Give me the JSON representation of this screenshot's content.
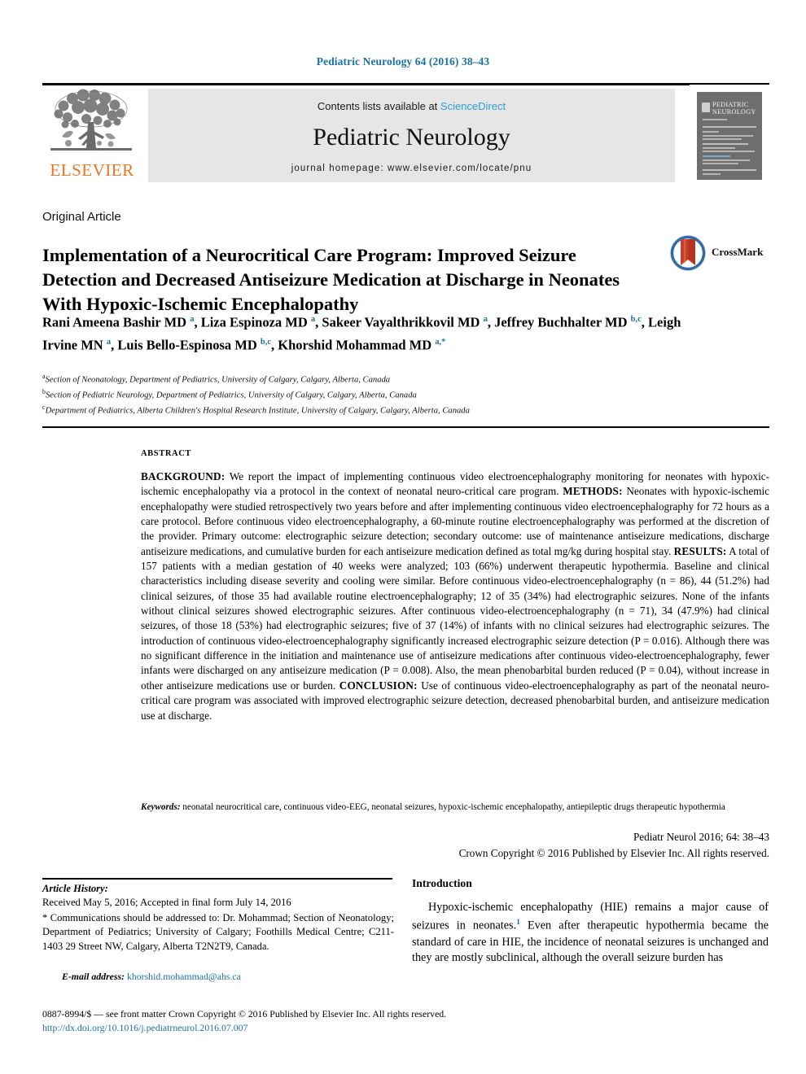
{
  "running_head": "Pediatric Neurology 64 (2016) 38–43",
  "masthead": {
    "contents_prefix": "Contents lists available at ",
    "sciencedirect": "ScienceDirect",
    "journal_title": "Pediatric Neurology",
    "homepage": "journal homepage: www.elsevier.com/locate/pnu",
    "publisher_logo_text": "ELSEVIER",
    "cover_title_line1": "PEDIATRIC",
    "cover_title_line2": "NEUROLOGY"
  },
  "article": {
    "type": "Original Article",
    "title": "Implementation of a Neurocritical Care Program: Improved Seizure Detection and Decreased Antiseizure Medication at Discharge in Neonates With Hypoxic-Ischemic Encephalopathy",
    "crossmark_label": "CrossMark",
    "authors_html": "Rani Ameena Bashir MD <sup>a</sup>, Liza Espinoza MD <sup>a</sup>, Sakeer Vayalthrikkovil MD <sup>a</sup>, Jeffrey Buchhalter MD <sup>b,c</sup>, Leigh Irvine MN <sup>a</sup>, Luis Bello-Espinosa MD <sup>b,c</sup>, Khorshid Mohammad MD <sup>a,</sup><sup>*</sup>",
    "affiliations": [
      {
        "marker": "a",
        "text": "Section of Neonatology, Department of Pediatrics, University of Calgary, Calgary, Alberta, Canada"
      },
      {
        "marker": "b",
        "text": "Section of Pediatric Neurology, Department of Pediatrics, University of Calgary, Calgary, Alberta, Canada"
      },
      {
        "marker": "c",
        "text": "Department of Pediatrics, Alberta Children's Hospital Research Institute, University of Calgary, Calgary, Alberta, Canada"
      }
    ]
  },
  "abstract": {
    "heading": "ABSTRACT",
    "sections": [
      {
        "label": "BACKGROUND:",
        "text": " We report the impact of implementing continuous video electroencephalography monitoring for neonates with hypoxic-ischemic encephalopathy via a protocol in the context of neonatal neuro-critical care program. "
      },
      {
        "label": "METHODS:",
        "text": " Neonates with hypoxic-ischemic encephalopathy were studied retrospectively two years before and after implementing continuous video electroencephalography for 72 hours as a care protocol. Before continuous video electroencephalography, a 60-minute routine electroencephalography was performed at the discretion of the provider. Primary outcome: electrographic seizure detection; secondary outcome: use of maintenance antiseizure medications, discharge antiseizure medications, and cumulative burden for each antiseizure medication defined as total mg/kg during hospital stay. "
      },
      {
        "label": "RESULTS:",
        "text": " A total of 157 patients with a median gestation of 40 weeks were analyzed; 103 (66%) underwent therapeutic hypothermia. Baseline and clinical characteristics including disease severity and cooling were similar. Before continuous video-electroencephalography (n = 86), 44 (51.2%) had clinical seizures, of those 35 had available routine electroencephalography; 12 of 35 (34%) had electrographic seizures. None of the infants without clinical seizures showed electrographic seizures. After continuous video-electroencephalography (n = 71), 34 (47.9%) had clinical seizures, of those 18 (53%) had electrographic seizures; five of 37 (14%) of infants with no clinical seizures had electrographic seizures. The introduction of continuous video-electroencephalography significantly increased electrographic seizure detection (P = 0.016). Although there was no significant difference in the initiation and maintenance use of antiseizure medications after continuous video-electroencephalography, fewer infants were discharged on any antiseizure medication (P = 0.008). Also, the mean phenobarbital burden reduced (P = 0.04), without increase in other antiseizure medications use or burden. "
      },
      {
        "label": "CONCLUSION:",
        "text": " Use of continuous video-electroencephalography as part of the neonatal neuro-critical care program was associated with improved electrographic seizure detection, decreased phenobarbital burden, and antiseizure medication use at discharge."
      }
    ],
    "keywords_label": "Keywords:",
    "keywords_text": " neonatal neurocritical care, continuous video-EEG, neonatal seizures, hypoxic-ischemic encephalopathy, antiepileptic drugs therapeutic hypothermia",
    "citation": "Pediatr Neurol 2016; 64: 38–43",
    "copyright": "Crown Copyright © 2016 Published by Elsevier Inc. All rights reserved."
  },
  "article_history": {
    "label": "Article History:",
    "dates": "Received May 5, 2016; Accepted in final form July 14, 2016",
    "correspondence": "* Communications should be addressed to: Dr. Mohammad; Section of Neonatology; Department of Pediatrics; University of Calgary; Foothills Medical Centre; C211-1403 29 Street NW, Calgary, Alberta T2N2T9, Canada.",
    "email_label": "E-mail address:",
    "email": " khorshid.mohammad@ahs.ca"
  },
  "introduction": {
    "heading": "Introduction",
    "paragraph_pre": "Hypoxic-ischemic encephalopathy (HIE) remains a major cause of seizures in neonates.",
    "reference_marker": "1",
    "paragraph_post": " Even after therapeutic hypothermia became the standard of care in HIE, the incidence of neonatal seizures is unchanged and they are mostly subclinical, although the overall seizure burden has"
  },
  "footer": {
    "issn_line": "0887-8994/$ — see front matter Crown Copyright © 2016 Published by Elsevier Inc. All rights reserved.",
    "doi": "http://dx.doi.org/10.1016/j.pediatrneurol.2016.07.007"
  },
  "colors": {
    "link_blue": "#1b72a8",
    "sciencedirect_blue": "#2a9fd6",
    "elsevier_orange": "#e87722",
    "masthead_gray": "#e6e6e6"
  }
}
